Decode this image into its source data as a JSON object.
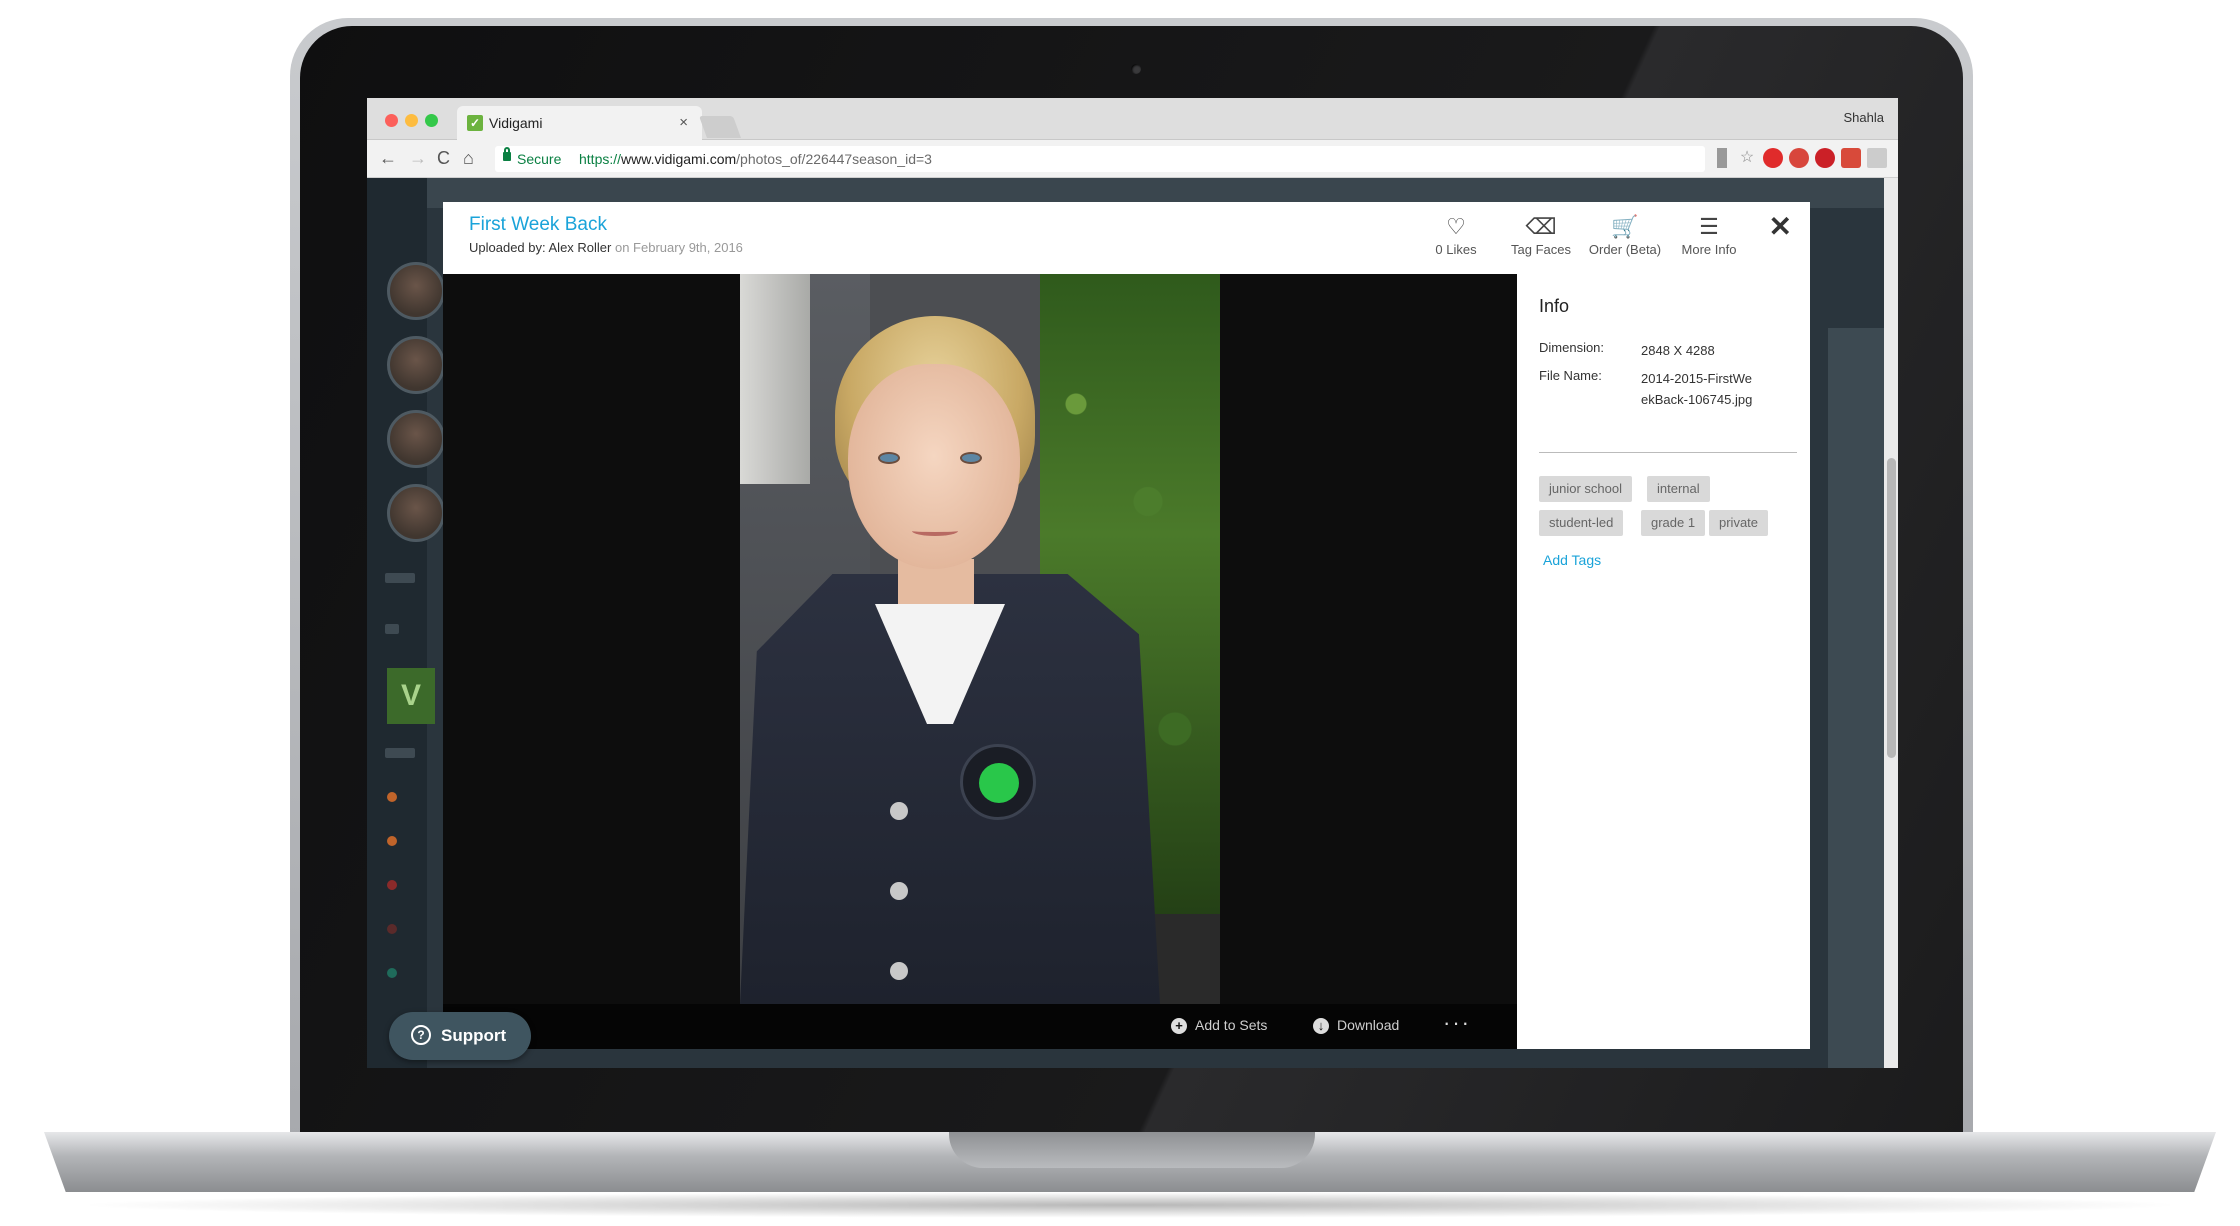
{
  "browser": {
    "tab_title": "Vidigami",
    "tab_close": "×",
    "user_name": "Shahla",
    "secure_label": "Secure",
    "url_scheme": "https://",
    "url_host": "www.vidigami.com",
    "url_path": "/photos_of/226447season_id=3",
    "nav": {
      "back": "←",
      "forward": "→",
      "reload": "C",
      "home": "⌂"
    }
  },
  "modal": {
    "title": "First Week Back",
    "uploaded_prefix": "Uploaded by: ",
    "uploader": "Alex Roller",
    "uploaded_suffix": " on February 9th, 2016",
    "actions": [
      {
        "label": "0 Likes",
        "icon": "heart-icon",
        "glyph": "♡"
      },
      {
        "label": "Tag Faces",
        "icon": "tag-icon",
        "glyph": "⌫"
      },
      {
        "label": "Order (Beta)",
        "icon": "cart-icon",
        "glyph": "🛒"
      },
      {
        "label": "More Info",
        "icon": "list-icon",
        "glyph": "☰"
      }
    ],
    "close": "✕",
    "footer": {
      "add_to_sets": "Add to Sets",
      "download": "Download",
      "more": "···"
    }
  },
  "info": {
    "title": "Info",
    "dimension_label": "Dimension:",
    "dimension_value": "2848 X 4288",
    "filename_label": "File Name:",
    "filename_value": "2014-2015-FirstWeekBack-106745.jpg",
    "tags": [
      "junior school",
      "internal",
      "student-led",
      "grade 1",
      "private"
    ],
    "add_tags": "Add Tags"
  },
  "support": {
    "label": "Support",
    "icon": "?"
  }
}
